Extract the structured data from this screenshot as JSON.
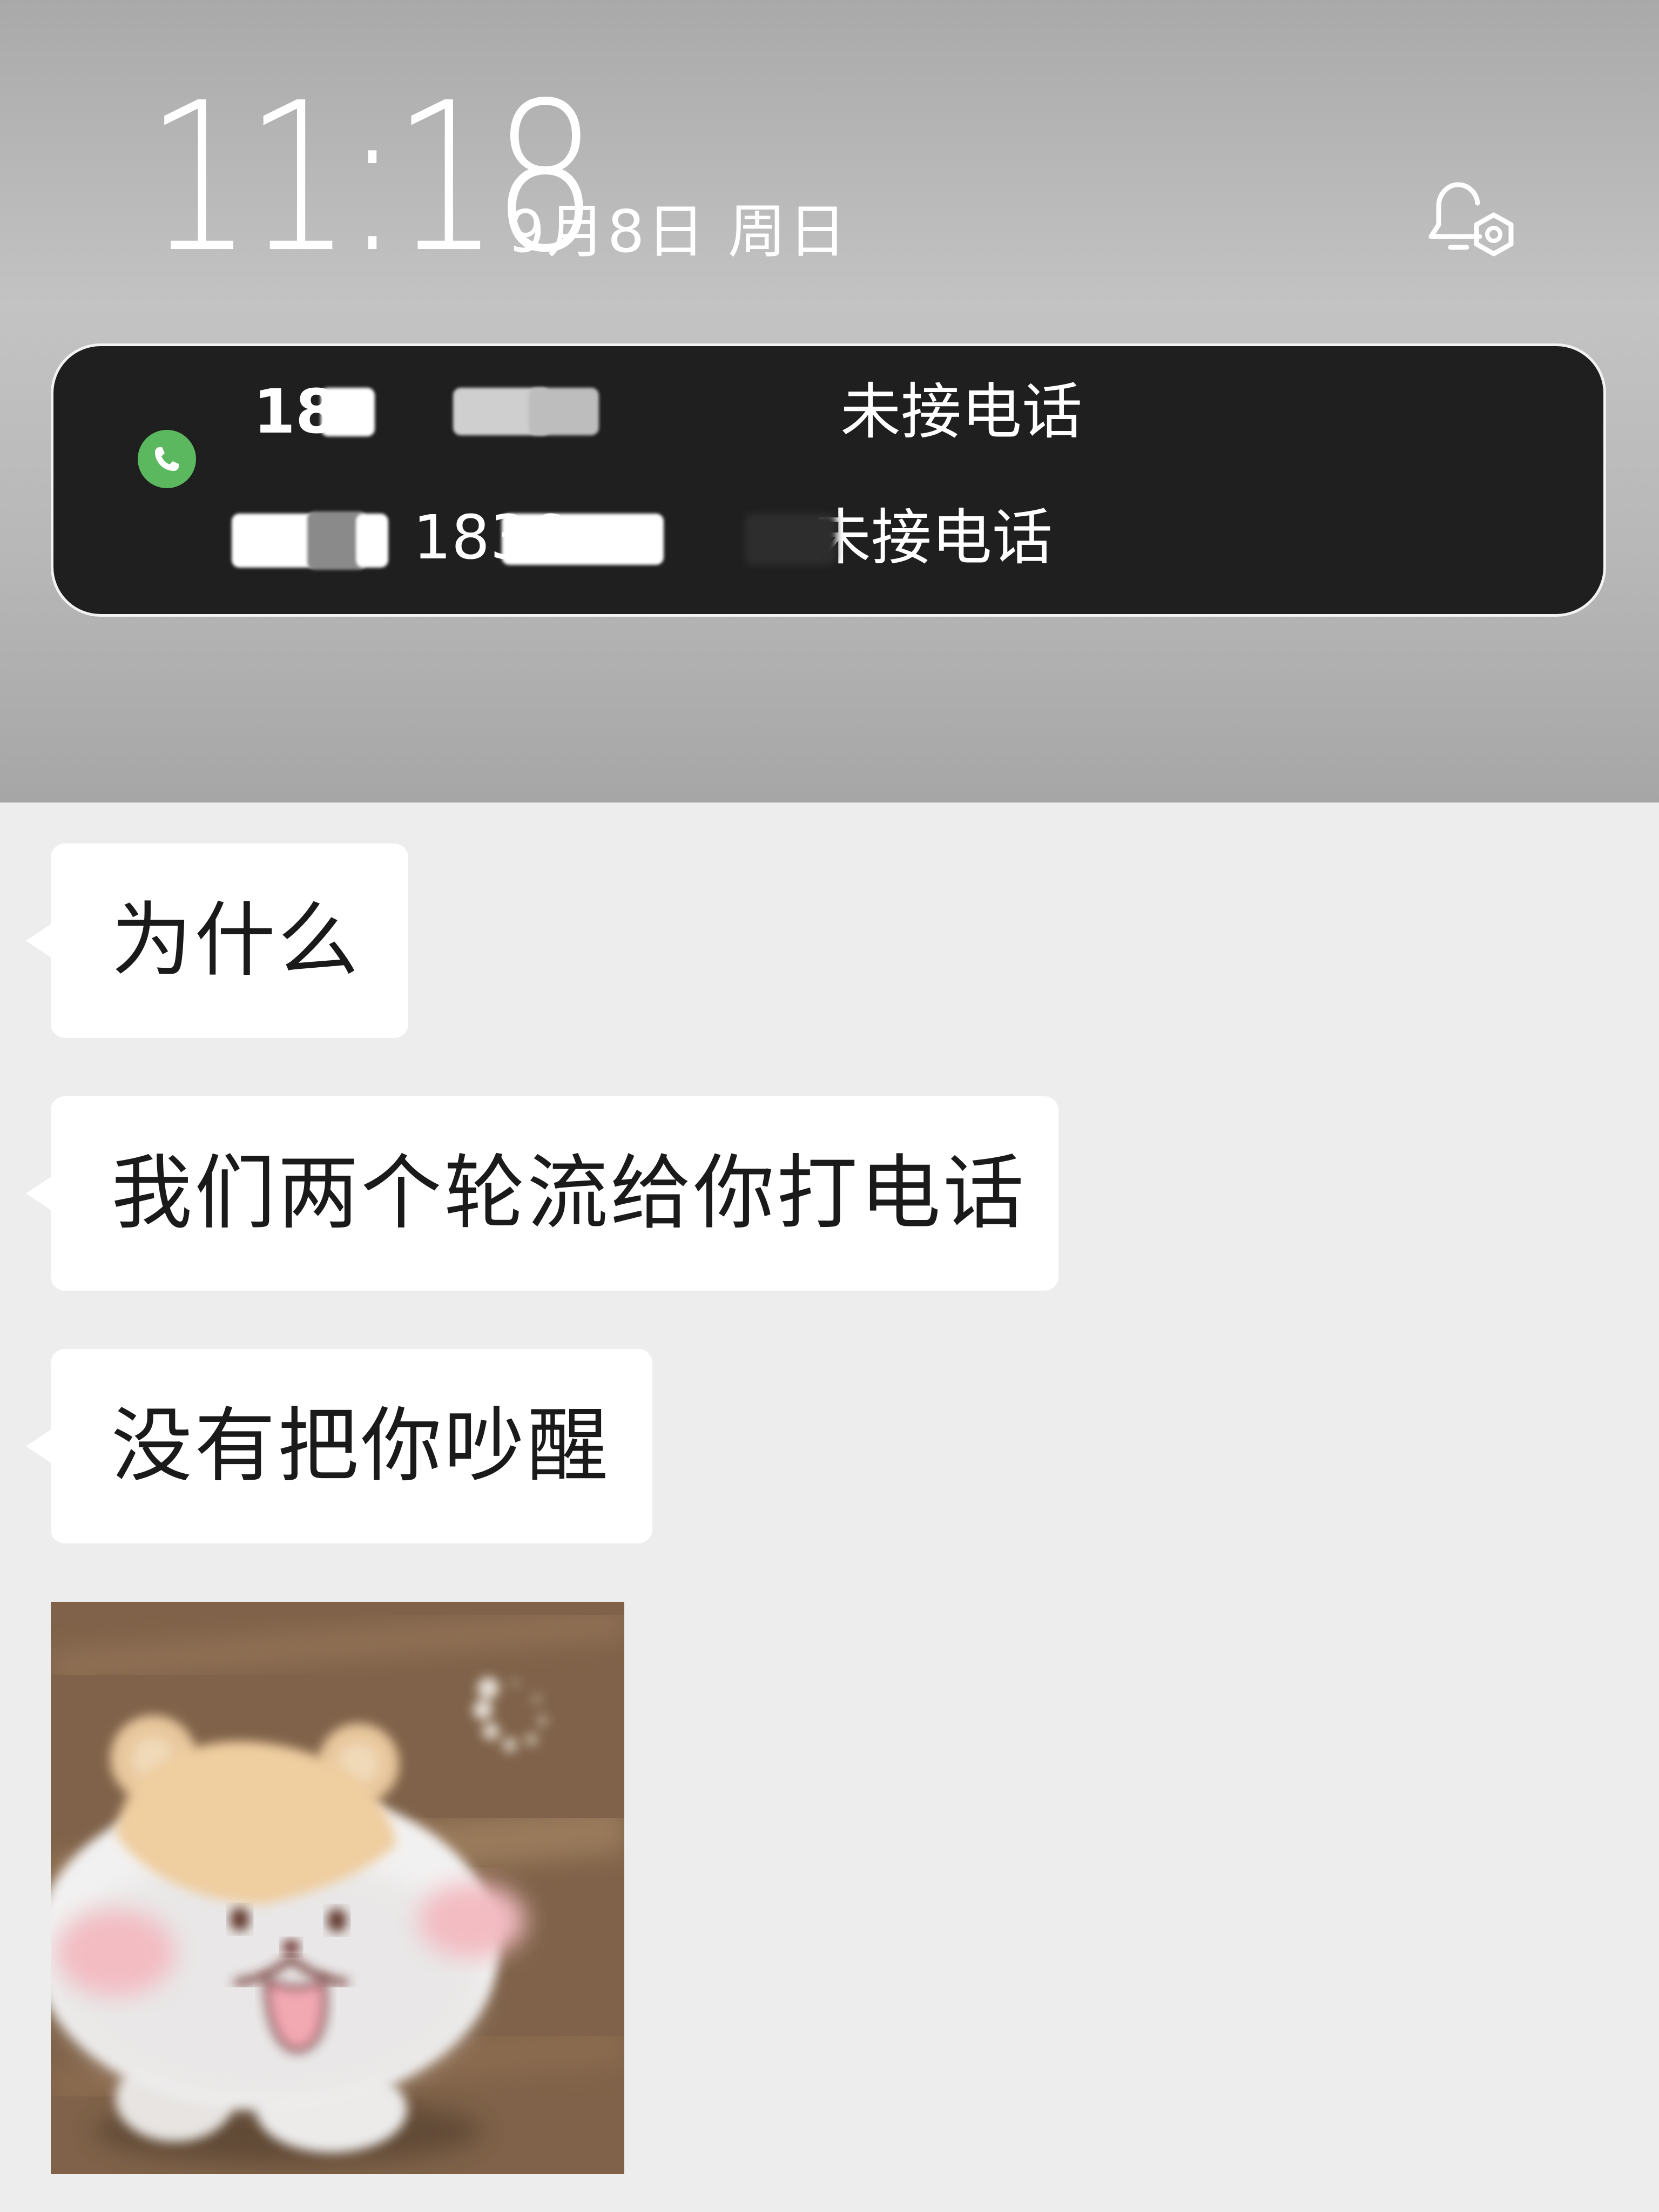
{
  "lock_screen": {
    "time": "11:18",
    "date": "9月8日 周日"
  },
  "notification": {
    "rows": [
      {
        "number_visible": "18",
        "status": "未接电话"
      },
      {
        "number_visible": "1836",
        "status": "未接电话"
      }
    ]
  },
  "chat": {
    "messages": [
      {
        "text": "为什么"
      },
      {
        "text": "我们两个轮流给你打电话"
      },
      {
        "text": "没有把你吵醒"
      }
    ]
  },
  "colors": {
    "call_icon": "#5bb85f",
    "card_bg": "#1f1f1f",
    "chat_bg": "#ededed",
    "bubble_bg": "#ffffff"
  },
  "icons": {
    "notification_icon": "phone-icon",
    "header_icon": "bell-settings-icon"
  }
}
